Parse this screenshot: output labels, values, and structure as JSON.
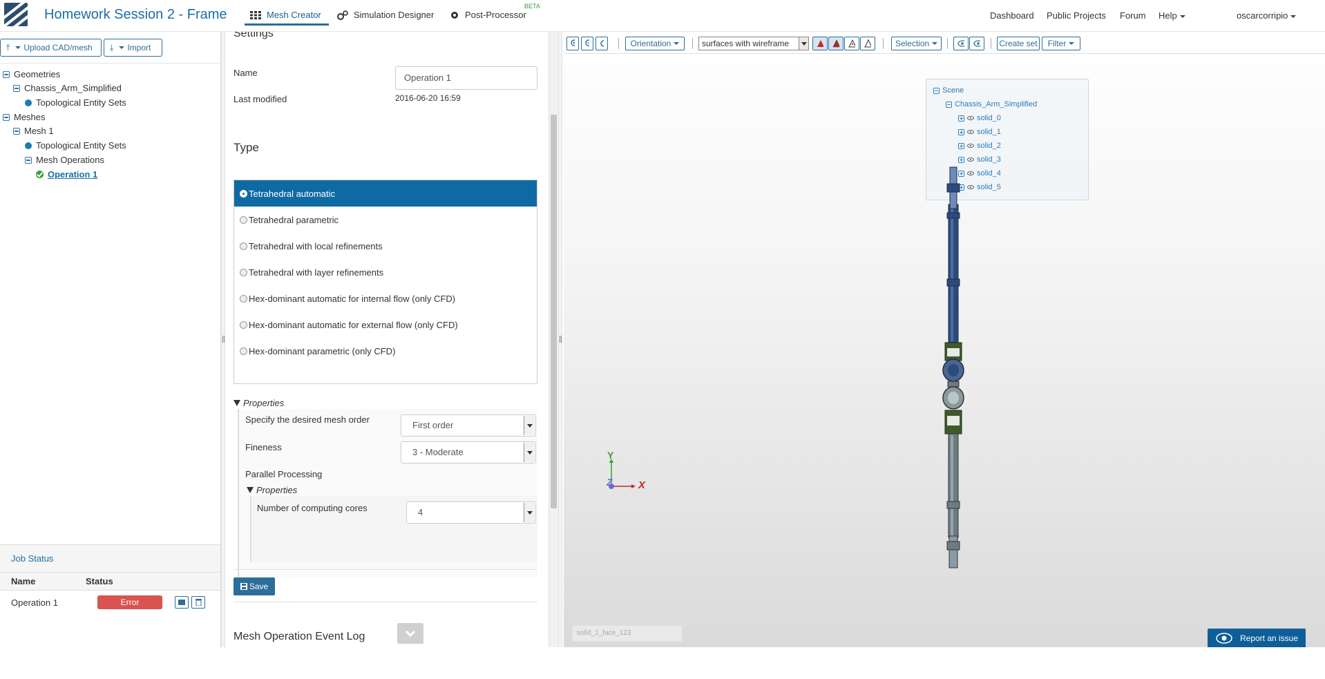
{
  "header": {
    "app_title": "Homework Session 2 - Frame",
    "tabs": [
      {
        "label": "Mesh Creator"
      },
      {
        "label": "Simulation Designer"
      },
      {
        "label": "Post-Processor"
      }
    ],
    "beta_label": "BETA",
    "right_links": [
      "Dashboard",
      "Public Projects",
      "Forum",
      "Help"
    ],
    "user_name": "oscarcorripio"
  },
  "left": {
    "upload_label": "Upload CAD/mesh",
    "import_label": "Import",
    "tree": {
      "geometries": "Geometries",
      "chassis": "Chassis_Arm_Simplified",
      "tes1": "Topological Entity Sets",
      "meshes": "Meshes",
      "mesh1": "Mesh 1",
      "tes2": "Topological Entity Sets",
      "mesh_ops": "Mesh Operations",
      "operation": "Operation 1"
    },
    "job_status": {
      "title": "Job Status",
      "col_name": "Name",
      "col_status": "Status",
      "row_name": "Operation 1",
      "row_status": "Error"
    }
  },
  "settings": {
    "section_title": "Settings",
    "name_label": "Name",
    "name_value": "Operation 1",
    "modified_label": "Last modified",
    "modified_value": "2016-06-20 16:59",
    "type_title": "Type",
    "types": [
      "Tetrahedral automatic",
      "Tetrahedral parametric",
      "Tetrahedral with local refinements",
      "Tetrahedral with layer refinements",
      "Hex-dominant automatic for internal flow (only CFD)",
      "Hex-dominant automatic for external flow (only CFD)",
      "Hex-dominant parametric (only CFD)"
    ],
    "selected_type": "Tetrahedral automatic",
    "properties_label": "Properties",
    "mesh_order_label": "Specify the desired mesh order",
    "mesh_order_value": "First order",
    "fineness_label": "Fineness",
    "fineness_value": "3 - Moderate",
    "parallel_label": "Parallel Processing",
    "sub_properties_label": "Properties",
    "cores_label": "Number of computing cores",
    "cores_value": "4",
    "save_label": "Save",
    "event_log_title": "Mesh Operation Event Log"
  },
  "viewer": {
    "toolbar": {
      "orientation": "Orientation",
      "render_mode": "surfaces with wireframe",
      "selection": "Selection",
      "create_set": "Create set",
      "filter": "Filter"
    },
    "scene": {
      "root": "Scene",
      "model": "Chassis_Arm_Simplified",
      "solids": [
        "solid_0",
        "solid_1",
        "solid_2",
        "solid_3",
        "solid_4",
        "solid_5"
      ]
    },
    "axis_labels": {
      "y": "Y",
      "z": "Z",
      "x": "X"
    },
    "status_field": "solid_1_face_123",
    "report_label": "Report an issue"
  },
  "colors": {
    "brand": "#1a6fa8",
    "selected": "#0f6aa3",
    "error": "#d9534f",
    "success": "#3a9a3a"
  }
}
